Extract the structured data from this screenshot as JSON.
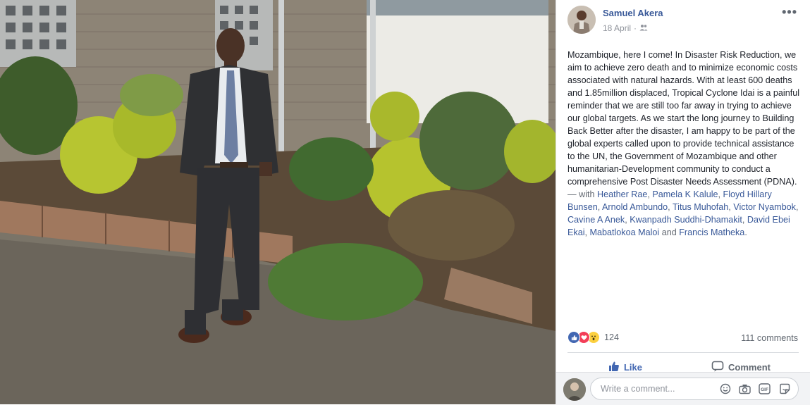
{
  "post": {
    "author": "Samuel Akera",
    "date": "18 April",
    "date_separator": "·",
    "audience_icon": "friends-icon",
    "more_label": "•••",
    "text_segments": [
      {
        "text": "Mozambique, here I come! In Disaster Risk Reduction, we aim to achieve zero death and to minimize economic costs associated with natural hazards. With at least 600 deaths and 1.85million displaced, Tropical Cyclone Idai is a painful reminder that we are still too far away in trying to achieve our global targets. As we start the long journey to Building Back Better after the disaster, I am happy to be part of the global experts called upon to provide technical assistance to the UN, the Government of Mozambique and other humanitarian-Development community to conduct a comprehensive Post Disaster Needs Assessment (PDNA).",
        "kind": "plain"
      },
      {
        "text": " — with ",
        "kind": "grey"
      },
      {
        "text": "Heather Rae",
        "kind": "tag"
      },
      {
        "text": ", ",
        "kind": "grey"
      },
      {
        "text": "Pamela K Kalule",
        "kind": "tag"
      },
      {
        "text": ", ",
        "kind": "grey"
      },
      {
        "text": "Floyd Hillary Bunsen",
        "kind": "tag"
      },
      {
        "text": ", ",
        "kind": "grey"
      },
      {
        "text": "Arnold Ambundo",
        "kind": "tag"
      },
      {
        "text": ", ",
        "kind": "grey"
      },
      {
        "text": "Titus Muhofah",
        "kind": "tag"
      },
      {
        "text": ", ",
        "kind": "grey"
      },
      {
        "text": "Victor Nyambok",
        "kind": "tag"
      },
      {
        "text": ", ",
        "kind": "grey"
      },
      {
        "text": "Cavine A Anek",
        "kind": "tag"
      },
      {
        "text": ", ",
        "kind": "grey"
      },
      {
        "text": "Kwanpadh Suddhi-Dhamakit",
        "kind": "tag"
      },
      {
        "text": ", ",
        "kind": "grey"
      },
      {
        "text": "David Ebei Ekai",
        "kind": "tag"
      },
      {
        "text": ", ",
        "kind": "grey"
      },
      {
        "text": "Mabatlokoa Maloi",
        "kind": "tag"
      },
      {
        "text": " and ",
        "kind": "grey"
      },
      {
        "text": "Francis Matheka",
        "kind": "tag"
      },
      {
        "text": ".",
        "kind": "grey"
      }
    ]
  },
  "reactions": {
    "icons": [
      "like-reaction-icon",
      "love-reaction-icon",
      "wow-reaction-icon"
    ],
    "count": "124",
    "comments": "111 comments"
  },
  "actions": {
    "like_label": "Like",
    "comment_label": "Comment"
  },
  "comment_box": {
    "placeholder": "Write a comment...",
    "icons": [
      "emoji-icon",
      "camera-icon",
      "gif-icon",
      "sticker-icon"
    ]
  },
  "colors": {
    "link": "#385898",
    "like_blue": "#4267b2",
    "love_red": "#f33e58",
    "wow_yellow": "#fcd03f"
  }
}
